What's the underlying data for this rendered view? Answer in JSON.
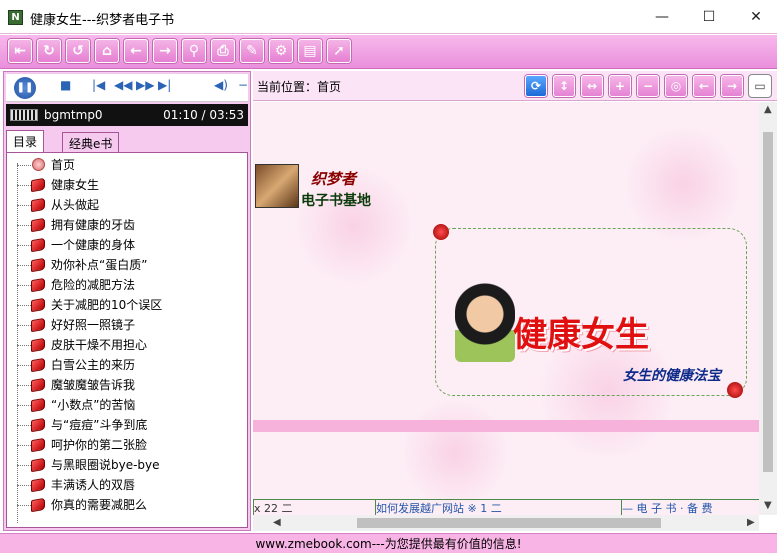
{
  "window": {
    "title": "健康女生---织梦者电子书",
    "app_icon_glyph": "N",
    "minimize": "—",
    "maximize": "☐",
    "close": "✕"
  },
  "toolbar": {
    "icons": [
      "exit-icon",
      "refresh-icon",
      "back-refresh-icon",
      "home-icon",
      "back-icon",
      "forward-icon",
      "search-icon",
      "print-icon",
      "favorites-icon",
      "settings-icon",
      "bookmark-icon",
      "select-icon"
    ]
  },
  "player": {
    "track_name": "bgmtmp0",
    "time": "01:10 / 03:53"
  },
  "tabs": [
    {
      "label": "目录"
    },
    {
      "label": "经典e书"
    }
  ],
  "tree": {
    "items": [
      {
        "label": "首页",
        "icon": "home-icon"
      },
      {
        "label": "健康女生",
        "icon": "book-icon"
      },
      {
        "label": "从头做起",
        "icon": "book-icon"
      },
      {
        "label": "拥有健康的牙齿",
        "icon": "book-icon"
      },
      {
        "label": "一个健康的身体",
        "icon": "book-icon"
      },
      {
        "label": "劝你补点“蛋白质”",
        "icon": "book-icon"
      },
      {
        "label": "危险的减肥方法",
        "icon": "book-icon"
      },
      {
        "label": "关于减肥的10个误区",
        "icon": "book-icon"
      },
      {
        "label": "好好照一照镜子",
        "icon": "book-icon"
      },
      {
        "label": "皮肤干燥不用担心",
        "icon": "book-icon"
      },
      {
        "label": "白雪公主的来历",
        "icon": "book-icon"
      },
      {
        "label": "魔皱魔皱告诉我",
        "icon": "book-icon"
      },
      {
        "label": "“小数点”的苦恼",
        "icon": "book-icon"
      },
      {
        "label": "与“痘痘”斗争到底",
        "icon": "book-icon"
      },
      {
        "label": "呵护你的第二张脸",
        "icon": "book-icon"
      },
      {
        "label": "与黑眼圈说bye-bye",
        "icon": "book-icon"
      },
      {
        "label": "丰满诱人的双唇",
        "icon": "book-icon"
      },
      {
        "label": "你真的需要减肥么",
        "icon": "book-icon"
      }
    ]
  },
  "nav": {
    "location_label": "当前位置：首页"
  },
  "content": {
    "logo_line1": "织梦者",
    "logo_line2": "电子书基地",
    "big_title": "健康女生",
    "subtitle": "女生的健康法宝",
    "bottom_cells": [
      "x 22 二",
      "如何发展越广网站 ※ 1 二",
      "— 电 子 书 · 备 费"
    ]
  },
  "status": {
    "text": "www.zmebook.com---为您提供最有价值的信息!"
  }
}
